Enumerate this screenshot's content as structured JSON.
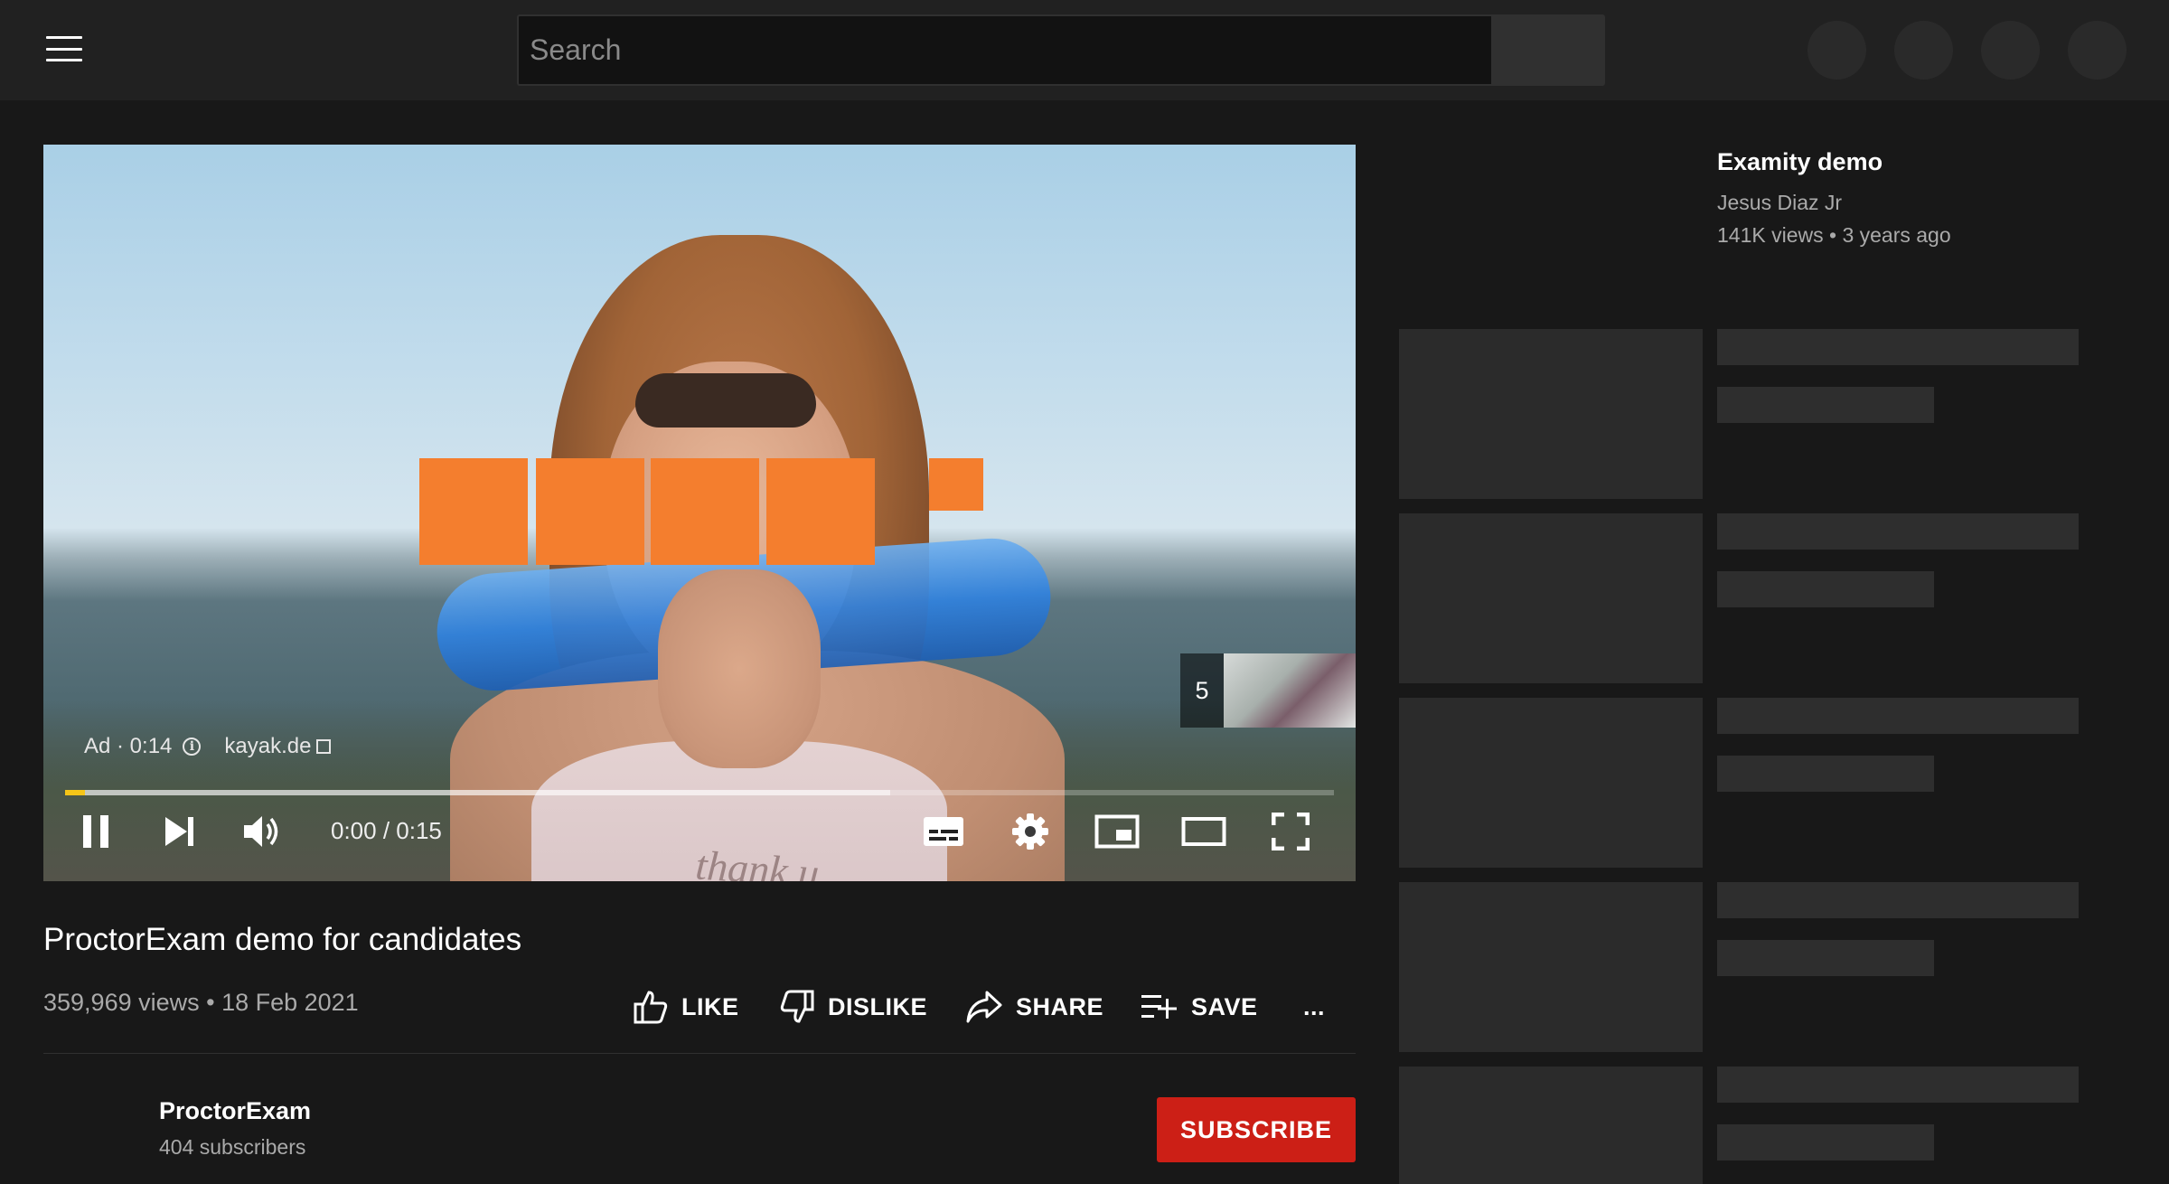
{
  "masthead": {
    "menu_icon": "hamburger-menu-icon",
    "search": {
      "placeholder": "Search",
      "value": ""
    },
    "search_button_icon": "search-icon"
  },
  "player": {
    "ad": {
      "label": "Ad · 0:14",
      "info_icon": "info-icon",
      "advertiser_link": "kayak.de",
      "link_icon": "external-link-icon",
      "skip_countdown": "5",
      "brand_color": "#f47e2e"
    },
    "shirt_text": "thank u",
    "time": "0:00 / 0:15",
    "progress": {
      "played_fraction": 0.016,
      "buffered_fraction": 0.65,
      "played_color": "#f5c518"
    }
  },
  "video": {
    "title": "ProctorExam demo for candidates",
    "meta": "359,969 views • 18 Feb 2021",
    "actions": {
      "like": "LIKE",
      "dislike": "DISLIKE",
      "share": "SHARE",
      "save": "SAVE",
      "more": "..."
    }
  },
  "channel": {
    "name": "ProctorExam",
    "subscribers": "404 subscribers",
    "subscribe_label": "SUBSCRIBE",
    "subscribe_color": "#cc1f16"
  },
  "sidebar": {
    "recommended": {
      "title": "Examity demo",
      "channel": "Jesus Diaz Jr",
      "meta": "141K views • 3 years ago"
    }
  }
}
